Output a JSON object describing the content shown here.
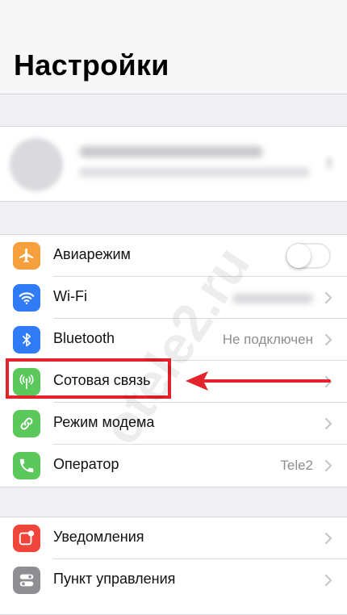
{
  "header": {
    "title": "Настройки"
  },
  "profile": {},
  "settings_group_1": [
    {
      "label": "Авиарежим",
      "icon": "airplane-icon",
      "color": "#f5a03c",
      "control": "toggle",
      "toggle_on": false
    },
    {
      "label": "Wi-Fi",
      "icon": "wifi-icon",
      "color": "#2f7cf6",
      "control": "chevron"
    },
    {
      "label": "Bluetooth",
      "icon": "bluetooth-icon",
      "color": "#2f7cf6",
      "control": "chevron",
      "value": "Не подключен"
    },
    {
      "label": "Сотовая связь",
      "icon": "antenna-icon",
      "color": "#5ac85a",
      "control": "chevron"
    },
    {
      "label": "Режим модема",
      "icon": "hotspot-icon",
      "color": "#5ac85a",
      "control": "chevron"
    },
    {
      "label": "Оператор",
      "icon": "phone-icon",
      "color": "#5ac85a",
      "control": "chevron",
      "value": "Tele2"
    }
  ],
  "settings_group_2": [
    {
      "label": "Уведомления",
      "icon": "notifications-icon",
      "color": "#f0453a",
      "control": "chevron"
    },
    {
      "label": "Пункт управления",
      "icon": "control-center-icon",
      "color": "#8e8e93",
      "control": "chevron"
    }
  ],
  "annotation": {
    "highlight_color": "#e32229"
  },
  "watermark": "otele2.ru"
}
